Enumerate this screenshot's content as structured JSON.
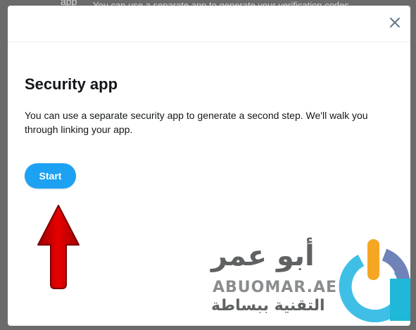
{
  "backdrop": {
    "app_label": "app",
    "partial_line": "You can use a separate app to generate your verification codes"
  },
  "modal": {
    "close_icon": "close-icon",
    "title": "Security app",
    "description": "You can use a separate security app to generate a second step. We'll walk you through linking your app.",
    "start_label": "Start"
  },
  "overlay": {
    "arrow_color": "#d40000",
    "arabic_name": "أبو عمر",
    "site": "ABUOMAR.AE",
    "arabic_tagline": "التقنية ببساطة"
  },
  "colors": {
    "accent": "#1da1f2",
    "title_text": "#14171a"
  }
}
